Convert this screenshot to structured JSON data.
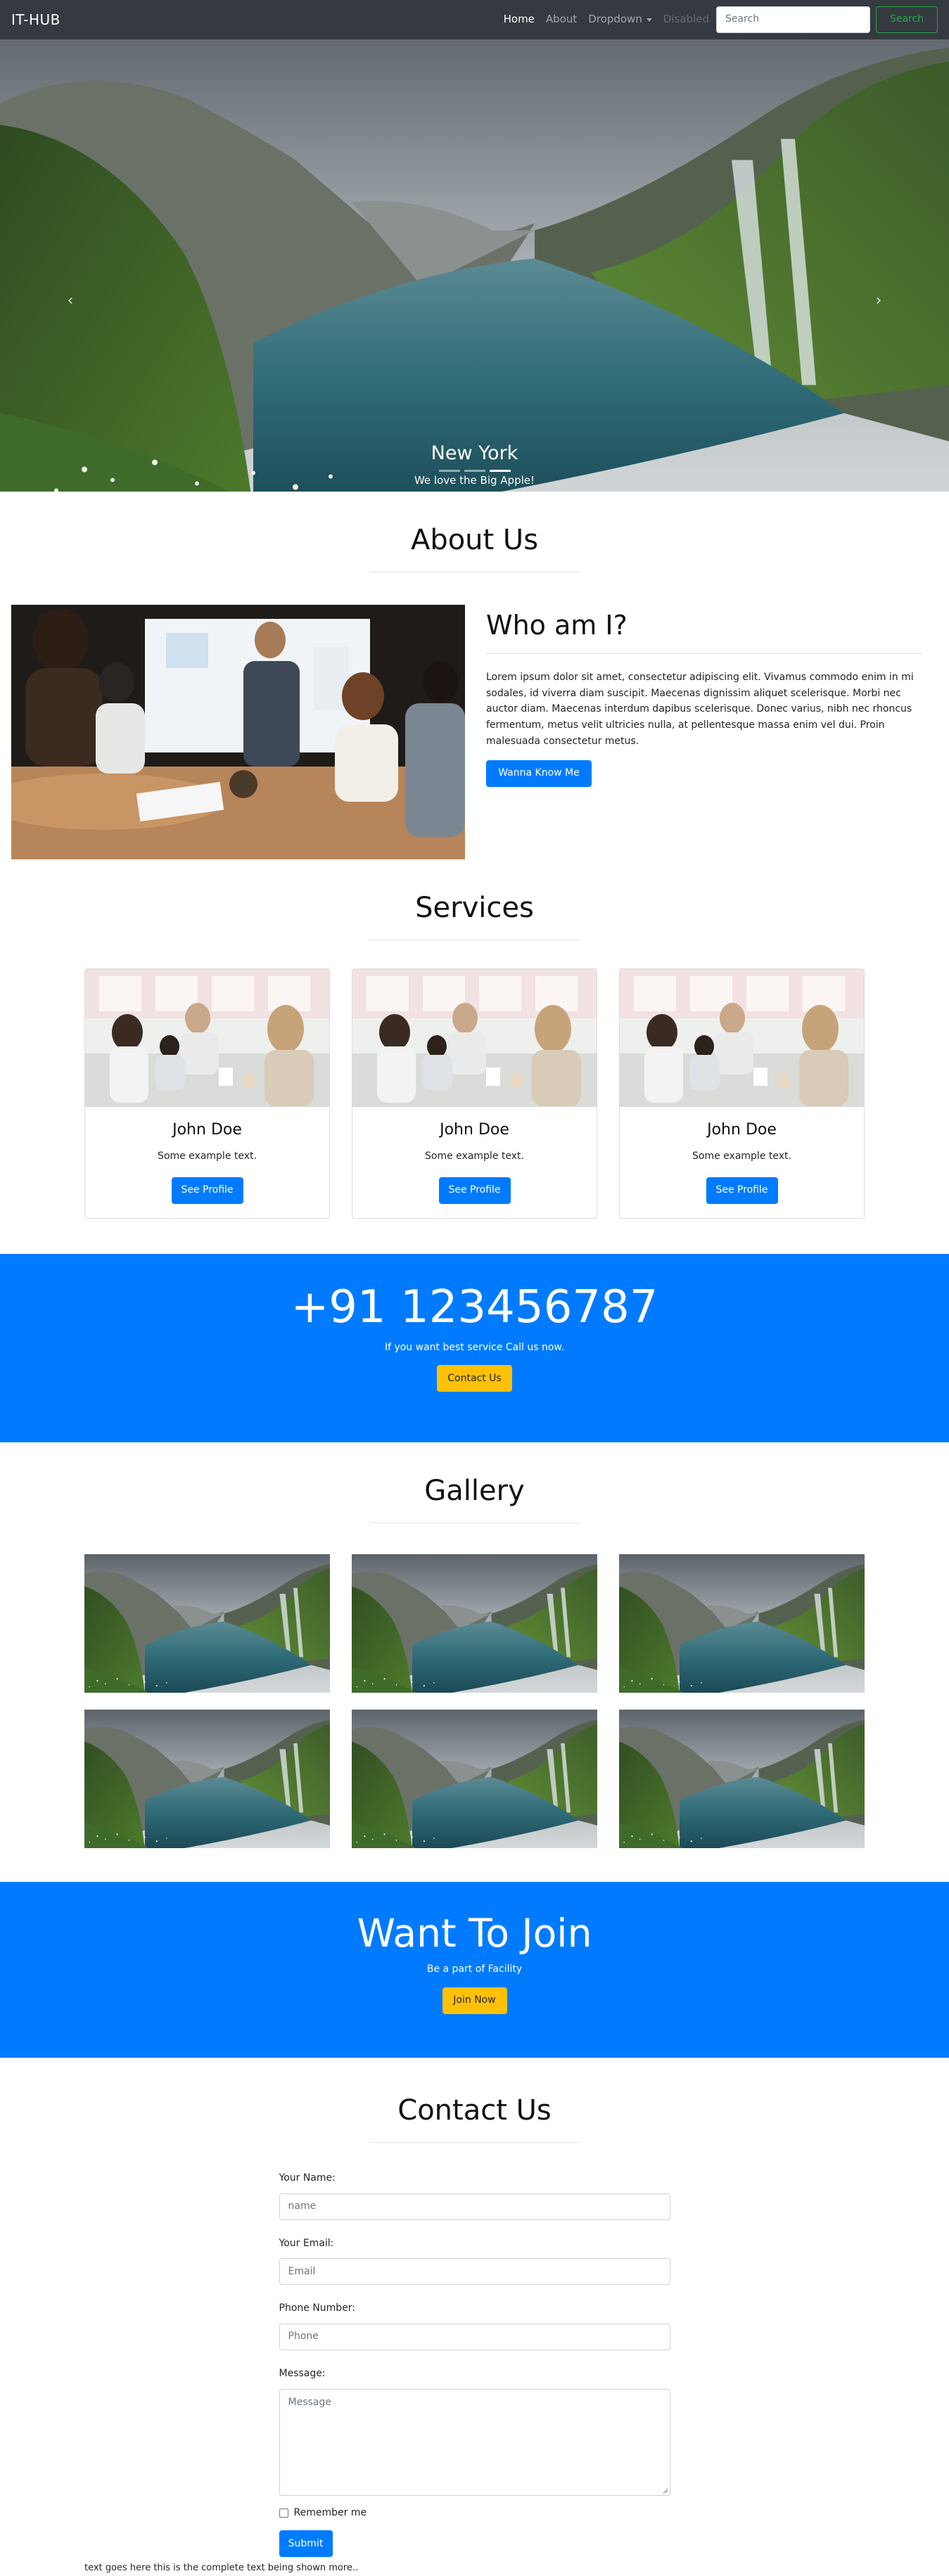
{
  "navbar": {
    "brand": "IT-HUB",
    "links": [
      {
        "label": "Home",
        "state": "active"
      },
      {
        "label": "About",
        "state": "normal"
      },
      {
        "label": "Dropdown",
        "state": "dropdown"
      },
      {
        "label": "Disabled",
        "state": "disabled"
      }
    ],
    "search_placeholder": "Search",
    "search_button": "Search"
  },
  "hero": {
    "title": "New York",
    "subtitle": "We love the Big Apple!",
    "slide_count": 3,
    "active_slide": 2
  },
  "about": {
    "heading": "About Us",
    "who_heading": "Who am I?",
    "paragraph": "Lorem ipsum dolor sit amet, consectetur adipiscing elit. Vivamus commodo enim in mi sodales, id viverra diam suscipit. Maecenas dignissim aliquet scelerisque. Morbi nec auctor diam. Maecenas interdum dapibus scelerisque. Donec varius, nibh nec rhoncus fermentum, metus velit ultricies nulla, at pellentesque massa enim vel dui. Proin malesuada consectetur metus.",
    "button": "Wanna Know Me"
  },
  "services": {
    "heading": "Services",
    "cards": [
      {
        "name": "John Doe",
        "text": "Some example text.",
        "button": "See Profile"
      },
      {
        "name": "John Doe",
        "text": "Some example text.",
        "button": "See Profile"
      },
      {
        "name": "John Doe",
        "text": "Some example text.",
        "button": "See Profile"
      }
    ]
  },
  "call": {
    "number": "+91 123456787",
    "text": "If you want best service Call us now.",
    "button": "Contact Us"
  },
  "gallery": {
    "heading": "Gallery",
    "image_count": 6
  },
  "join": {
    "title": "Want To Join",
    "text": "Be a part of Facility",
    "button": "Join Now"
  },
  "contact": {
    "heading": "Contact Us",
    "name_label": "Your Name:",
    "name_placeholder": "name",
    "email_label": "Your Email:",
    "email_placeholder": "Email",
    "phone_label": "Phone Number:",
    "phone_placeholder": "Phone",
    "message_label": "Message:",
    "message_placeholder": "Message",
    "remember_label": "Remember me",
    "submit": "Submit",
    "footer_text": "text goes here this is the complete text being shown more.."
  },
  "colors": {
    "navbar_bg": "#343a40",
    "primary": "#007bff",
    "warning": "#ffc107",
    "success": "#28a745"
  }
}
